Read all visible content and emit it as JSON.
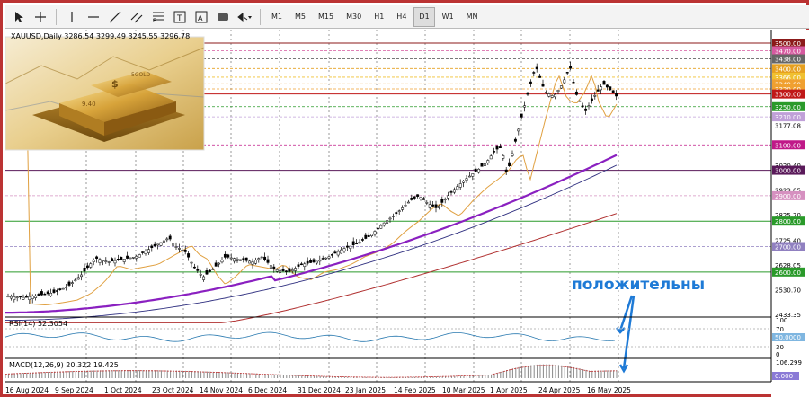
{
  "toolbar": {
    "timeframes": [
      "M1",
      "M5",
      "M15",
      "M30",
      "H1",
      "H4",
      "D1",
      "W1",
      "MN"
    ],
    "active_timeframe": "D1"
  },
  "chart_info": {
    "symbol_line": "XAUUSD,Daily  3286.54 3299.49 3245.55 3296.78"
  },
  "price_labels": [
    "3500.00",
    "3470.00",
    "3438.00",
    "3400.00",
    "3366.00",
    "3340.00",
    "3320.00",
    "3300.00",
    "3250.00",
    "3210.00",
    "3177.08",
    "3100.00",
    "3020.40",
    "3000.00",
    "2923.05",
    "2900.00",
    "2825.70",
    "2800.00",
    "2725.40",
    "2700.00",
    "2628.05",
    "2600.00",
    "2530.70",
    "2433.35"
  ],
  "boxed_labels": [
    {
      "text": "3500.00",
      "color": "#8b1a1a"
    },
    {
      "text": "3470.00",
      "color": "#d65aa0"
    },
    {
      "text": "3438.00",
      "color": "#666666"
    },
    {
      "text": "3400.00",
      "color": "#e6a020"
    },
    {
      "text": "3366.00",
      "color": "#f0c030"
    },
    {
      "text": "3340.00",
      "color": "#f0a030"
    },
    {
      "text": "3320.00",
      "color": "#f0a030"
    },
    {
      "text": "3300.00",
      "color": "#c01818"
    },
    {
      "text": "3250.00",
      "color": "#2a9a2a"
    },
    {
      "text": "3210.00",
      "color": "#c0a0d8"
    },
    {
      "text": "3100.00",
      "color": "#c01888"
    },
    {
      "text": "3000.00",
      "color": "#5a1a5a"
    },
    {
      "text": "2900.00",
      "color": "#d690c0"
    },
    {
      "text": "2800.00",
      "color": "#2a9a2a"
    },
    {
      "text": "2700.00",
      "color": "#9080c0"
    },
    {
      "text": "2600.00",
      "color": "#2a9a2a"
    }
  ],
  "date_labels": [
    "16 Aug 2024",
    "9 Sep 2024",
    "1 Oct 2024",
    "23 Oct 2024",
    "14 Nov 2024",
    "6 Dec 2024",
    "31 Dec 2024",
    "23 Jan 2025",
    "14 Feb 2025",
    "10 Mar 2025",
    "1 Apr 2025",
    "24 Apr 2025",
    "16 May 2025"
  ],
  "annotation": "положительны",
  "rsi": {
    "label": "RSI(14) 52.3054",
    "levels": [
      "100",
      "70",
      "50.0000",
      "30",
      "0"
    ]
  },
  "macd": {
    "label": "MACD(12,26,9) 20.322 19.425",
    "levels": [
      "106.299",
      "0.000"
    ]
  },
  "colors": {
    "frame": "#b33333",
    "ma_fast": "#e0a040",
    "ma_mid": "#8a20c0",
    "ma_slow": "#303080",
    "ma_long": "#b03030",
    "annotation": "#1e7ad6"
  }
}
